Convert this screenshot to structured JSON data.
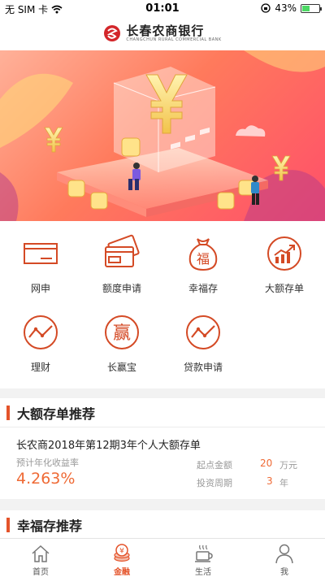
{
  "status_bar": {
    "carrier": "无 SIM 卡",
    "time": "01:01",
    "battery": "43%",
    "battery_level": 0.43
  },
  "header": {
    "logo_cn": "长春农商银行",
    "logo_en": "CHANGCHUN RURAL COMMERCIAL BANK"
  },
  "banner": {
    "icons": [
      "yen-coin-icon"
    ]
  },
  "services": [
    {
      "label": "网申",
      "icon": "card-window-icon"
    },
    {
      "label": "额度申请",
      "icon": "bank-card-icon"
    },
    {
      "label": "幸福存",
      "icon": "fu-bag-icon"
    },
    {
      "label": "大额存单",
      "icon": "trend-up-icon"
    },
    {
      "label": "理财",
      "icon": "wave-chart-icon"
    },
    {
      "label": "长赢宝",
      "icon": "ying-icon"
    },
    {
      "label": "贷款申请",
      "icon": "wave-chart-icon"
    }
  ],
  "section1": {
    "title": "大额存单推荐",
    "product": "长农商2018年第12期3年个人大额存单",
    "rate_label": "预计年化收益率",
    "rate_value": "4.263%",
    "min_label": "起点金额",
    "min_value": "20",
    "min_unit": "万元",
    "term_label": "投资周期",
    "term_value": "3",
    "term_unit": "年"
  },
  "section2": {
    "title": "幸福存推荐"
  },
  "tabbar": {
    "tabs": [
      {
        "label": "首页",
        "icon": "home-icon"
      },
      {
        "label": "金融",
        "icon": "coin-stack-icon"
      },
      {
        "label": "生活",
        "icon": "coffee-cup-icon"
      },
      {
        "label": "我",
        "icon": "person-icon"
      }
    ],
    "active": "金融",
    "accent": "#e4532a"
  }
}
